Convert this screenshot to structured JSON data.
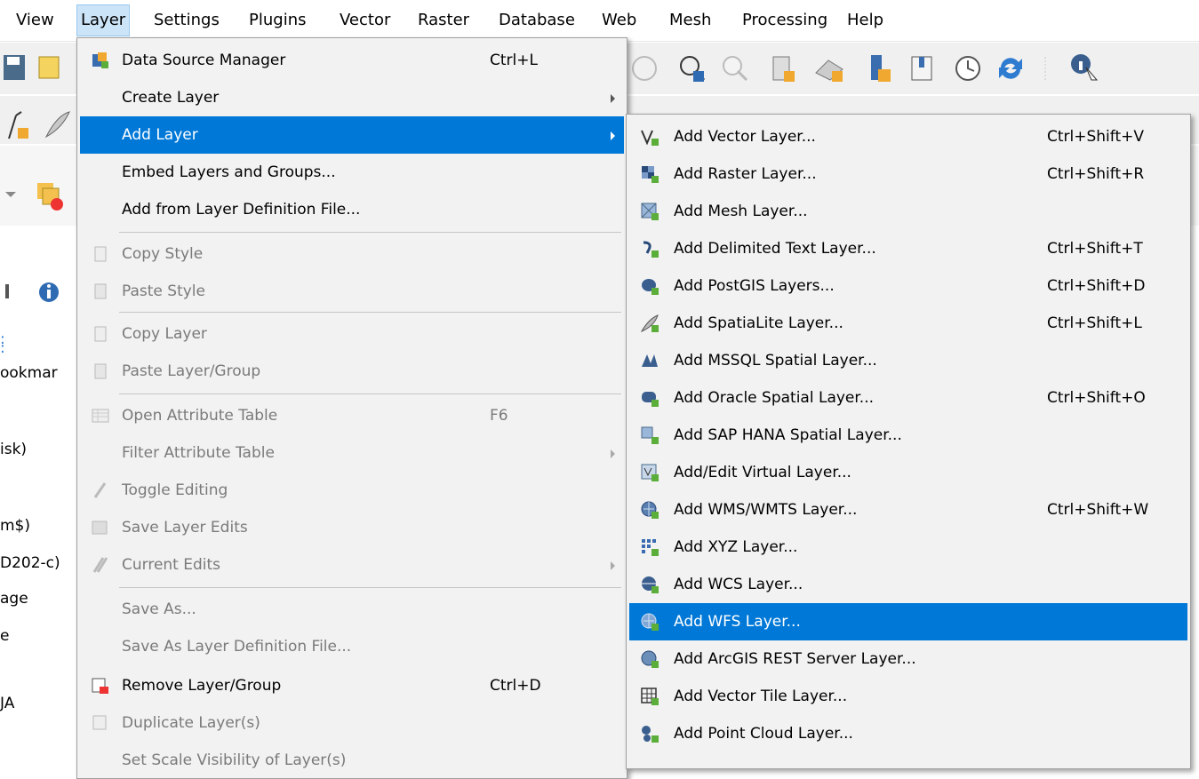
{
  "menubar": {
    "items": [
      "View",
      "Layer",
      "Settings",
      "Plugins",
      "Vector",
      "Raster",
      "Database",
      "Web",
      "Mesh",
      "Processing",
      "Help"
    ],
    "active": "Layer"
  },
  "background": {
    "panel_lines": [
      ":",
      ":",
      "ookmar",
      "isk)",
      "m$)",
      "D202-c)",
      "age",
      "e",
      "JA"
    ]
  },
  "layer_menu": {
    "items": [
      {
        "label": "Data Source Manager",
        "shortcut": "Ctrl+L",
        "icon": "data-source-manager-icon",
        "enabled": true
      },
      {
        "label": "Create Layer",
        "submenu": true,
        "enabled": true
      },
      {
        "label": "Add Layer",
        "submenu": true,
        "enabled": true,
        "highlighted": true
      },
      {
        "label": "Embed Layers and Groups...",
        "enabled": true
      },
      {
        "label": "Add from Layer Definition File...",
        "enabled": true
      },
      {
        "label": "Copy Style",
        "icon": "copy-style-icon",
        "enabled": false
      },
      {
        "label": "Paste Style",
        "icon": "paste-style-icon",
        "enabled": false
      },
      {
        "label": "Copy Layer",
        "icon": "copy-layer-icon",
        "enabled": false
      },
      {
        "label": "Paste Layer/Group",
        "icon": "paste-layer-icon",
        "enabled": false
      },
      {
        "label": "Open Attribute Table",
        "shortcut": "F6",
        "icon": "attribute-table-icon",
        "enabled": false
      },
      {
        "label": "Filter Attribute Table",
        "submenu": true,
        "enabled": false
      },
      {
        "label": "Toggle Editing",
        "icon": "pencil-icon",
        "enabled": false
      },
      {
        "label": "Save Layer Edits",
        "icon": "save-edits-icon",
        "enabled": false
      },
      {
        "label": "Current Edits",
        "submenu": true,
        "icon": "current-edits-icon",
        "enabled": false
      },
      {
        "label": "Save As...",
        "enabled": false
      },
      {
        "label": "Save As Layer Definition File...",
        "enabled": false
      },
      {
        "label": "Remove Layer/Group",
        "shortcut": "Ctrl+D",
        "icon": "remove-layer-icon",
        "enabled": true
      },
      {
        "label": "Duplicate Layer(s)",
        "icon": "duplicate-layer-icon",
        "enabled": false
      },
      {
        "label": "Set Scale Visibility of Layer(s)",
        "enabled": false
      }
    ]
  },
  "add_layer_submenu": {
    "items": [
      {
        "label": "Add Vector Layer...",
        "shortcut": "Ctrl+Shift+V",
        "icon": "vector-layer-icon"
      },
      {
        "label": "Add Raster Layer...",
        "shortcut": "Ctrl+Shift+R",
        "icon": "raster-layer-icon"
      },
      {
        "label": "Add Mesh Layer...",
        "icon": "mesh-layer-icon"
      },
      {
        "label": "Add Delimited Text Layer...",
        "shortcut": "Ctrl+Shift+T",
        "icon": "delimited-text-icon"
      },
      {
        "label": "Add PostGIS Layers...",
        "shortcut": "Ctrl+Shift+D",
        "icon": "postgis-icon"
      },
      {
        "label": "Add SpatiaLite Layer...",
        "shortcut": "Ctrl+Shift+L",
        "icon": "spatialite-icon"
      },
      {
        "label": "Add MSSQL Spatial Layer...",
        "icon": "mssql-icon"
      },
      {
        "label": "Add Oracle Spatial Layer...",
        "shortcut": "Ctrl+Shift+O",
        "icon": "oracle-icon"
      },
      {
        "label": "Add SAP HANA Spatial Layer...",
        "icon": "sap-hana-icon"
      },
      {
        "label": "Add/Edit Virtual Layer...",
        "icon": "virtual-layer-icon"
      },
      {
        "label": "Add WMS/WMTS Layer...",
        "shortcut": "Ctrl+Shift+W",
        "icon": "wms-icon"
      },
      {
        "label": "Add XYZ Layer...",
        "icon": "xyz-icon"
      },
      {
        "label": "Add WCS Layer...",
        "icon": "wcs-icon"
      },
      {
        "label": "Add WFS Layer...",
        "icon": "wfs-icon",
        "highlighted": true
      },
      {
        "label": "Add ArcGIS REST Server Layer...",
        "icon": "arcgis-icon"
      },
      {
        "label": "Add Vector Tile Layer...",
        "icon": "vector-tile-icon"
      },
      {
        "label": "Add Point Cloud Layer...",
        "icon": "point-cloud-icon"
      }
    ]
  }
}
